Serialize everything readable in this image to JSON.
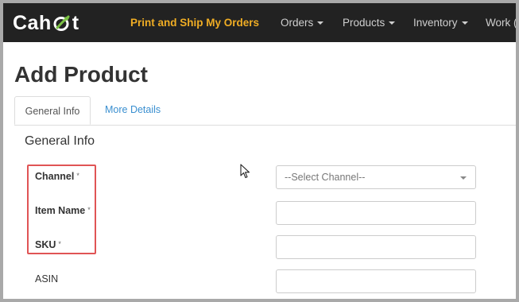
{
  "brand": {
    "logo_text_prefix": "Cah",
    "logo_text_suffix": "t",
    "logo_icon": "leaf-o-icon"
  },
  "navbar": {
    "items": [
      {
        "label": "Print and Ship My Orders",
        "highlight": true
      },
      {
        "label": "Orders",
        "dropdown": true
      },
      {
        "label": "Products",
        "dropdown": true
      },
      {
        "label": "Inventory",
        "dropdown": true
      },
      {
        "label": "Work ("
      }
    ]
  },
  "page": {
    "title": "Add Product"
  },
  "tabs": {
    "active_label": "General Info",
    "other_label": "More Details"
  },
  "form": {
    "section_title": "General Info",
    "required_marker": "*",
    "fields": [
      {
        "label": "Channel",
        "required": true,
        "type": "select",
        "placeholder": "--Select Channel--"
      },
      {
        "label": "Item Name",
        "required": true,
        "type": "text",
        "value": ""
      },
      {
        "label": "SKU",
        "required": true,
        "type": "text",
        "value": ""
      },
      {
        "label": "ASIN",
        "required": false,
        "type": "text",
        "value": ""
      }
    ]
  },
  "colors": {
    "navbar_bg": "#222222",
    "highlight_nav": "#f0ad24",
    "link": "#3a8fd0",
    "annotation_box": "#e05455"
  }
}
